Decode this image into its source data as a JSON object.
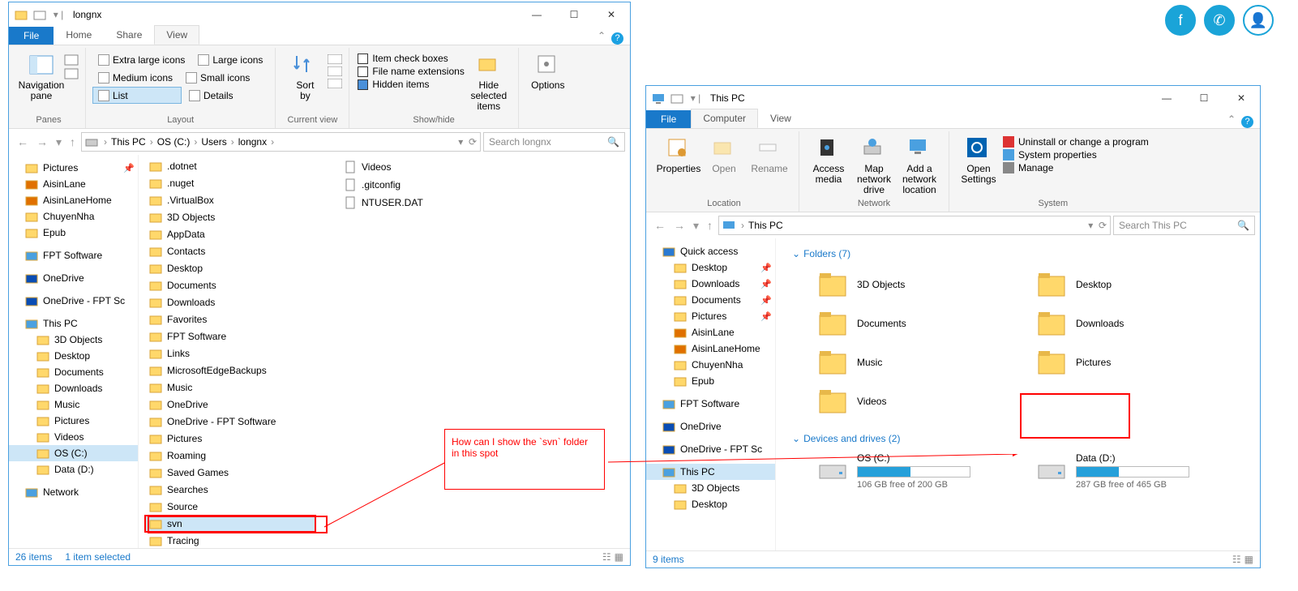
{
  "annotation_text": "How can I show the `svn` folder in this spot",
  "window1": {
    "title": "longnx",
    "tabs": {
      "file": "File",
      "home": "Home",
      "share": "Share",
      "view": "View"
    },
    "ribbon": {
      "panes": "Panes",
      "navpane": "Navigation\npane",
      "layout": "Layout",
      "layout_opts": {
        "xl": "Extra large icons",
        "li": "Large icons",
        "mi": "Medium icons",
        "si": "Small icons",
        "list": "List",
        "details": "Details"
      },
      "currentview": "Current view",
      "sortby": "Sort\nby",
      "showhide": "Show/hide",
      "checks": {
        "icb": "Item check boxes",
        "fne": "File name extensions",
        "hi": "Hidden items"
      },
      "hidesel": "Hide selected\nitems",
      "options": "Options"
    },
    "breadcrumbs": [
      "This PC",
      "OS (C:)",
      "Users",
      "longnx"
    ],
    "search_placeholder": "Search longnx",
    "nav": [
      {
        "t": "Pictures",
        "pin": true
      },
      {
        "t": "AisinLane",
        "pin": false,
        "c": "#e07000"
      },
      {
        "t": "AisinLaneHome",
        "c": "#e07000"
      },
      {
        "t": "ChuyenNha"
      },
      {
        "t": "Epub"
      },
      {
        "t": "",
        "spacer": true
      },
      {
        "t": "FPT Software",
        "c": "#4aa0e0"
      },
      {
        "t": "",
        "spacer": true
      },
      {
        "t": "OneDrive",
        "c": "#0a4db3"
      },
      {
        "t": "",
        "spacer": true
      },
      {
        "t": "OneDrive - FPT Sc",
        "c": "#0a4db3"
      },
      {
        "t": "",
        "spacer": true
      },
      {
        "t": "This PC",
        "c": "#4aa0e0",
        "selectedGroup": true
      },
      {
        "t": "3D Objects",
        "sub": true
      },
      {
        "t": "Desktop",
        "sub": true
      },
      {
        "t": "Documents",
        "sub": true
      },
      {
        "t": "Downloads",
        "sub": true
      },
      {
        "t": "Music",
        "sub": true
      },
      {
        "t": "Pictures",
        "sub": true
      },
      {
        "t": "Videos",
        "sub": true
      },
      {
        "t": "OS (C:)",
        "sub": true,
        "selected": true
      },
      {
        "t": "Data (D:)",
        "sub": true
      },
      {
        "t": "",
        "spacer": true
      },
      {
        "t": "Network",
        "c": "#4aa0e0"
      }
    ],
    "col1": [
      ".dotnet",
      ".nuget",
      ".VirtualBox",
      "3D Objects",
      "AppData",
      "Contacts",
      "Desktop",
      "Documents",
      "Downloads",
      "Favorites",
      "FPT Software",
      "Links",
      "MicrosoftEdgeBackups",
      "Music",
      "OneDrive",
      "OneDrive - FPT Software",
      "Pictures",
      "Roaming",
      "Saved Games",
      "Searches",
      "Source",
      "svn",
      "Tracing"
    ],
    "col2": [
      "Videos",
      ".gitconfig",
      "NTUSER.DAT"
    ],
    "status": {
      "items": "26 items",
      "sel": "1 item selected"
    }
  },
  "window2": {
    "title": "This PC",
    "tabs": {
      "file": "File",
      "computer": "Computer",
      "view": "View"
    },
    "ribbon": {
      "location": "Location",
      "prop": "Properties",
      "open": "Open",
      "rename": "Rename",
      "network": "Network",
      "am": "Access\nmedia",
      "mnd": "Map network\ndrive",
      "anl": "Add a network\nlocation",
      "system": "System",
      "os": "Open\nSettings",
      "links": {
        "u": "Uninstall or change a program",
        "sp": "System properties",
        "m": "Manage"
      }
    },
    "breadcrumb": "This PC",
    "search_placeholder": "Search This PC",
    "nav": [
      {
        "t": "Quick access",
        "c": "#2a7ad2",
        "star": true
      },
      {
        "t": "Desktop",
        "sub": true,
        "pin": true
      },
      {
        "t": "Downloads",
        "sub": true,
        "pin": true
      },
      {
        "t": "Documents",
        "sub": true,
        "pin": true
      },
      {
        "t": "Pictures",
        "sub": true,
        "pin": true
      },
      {
        "t": "AisinLane",
        "sub": true,
        "c": "#e07000"
      },
      {
        "t": "AisinLaneHome",
        "sub": true,
        "c": "#e07000"
      },
      {
        "t": "ChuyenNha",
        "sub": true
      },
      {
        "t": "Epub",
        "sub": true
      },
      {
        "t": "",
        "spacer": true
      },
      {
        "t": "FPT Software",
        "c": "#4aa0e0"
      },
      {
        "t": "",
        "spacer": true
      },
      {
        "t": "OneDrive",
        "c": "#0a4db3"
      },
      {
        "t": "",
        "spacer": true
      },
      {
        "t": "OneDrive - FPT Sc",
        "c": "#0a4db3"
      },
      {
        "t": "",
        "spacer": true
      },
      {
        "t": "This PC",
        "c": "#4aa0e0",
        "selected": true
      },
      {
        "t": "3D Objects",
        "sub": true
      },
      {
        "t": "Desktop",
        "sub": true
      }
    ],
    "folders_hdr": "Folders (7)",
    "folders": [
      "3D Objects",
      "Desktop",
      "Documents",
      "Downloads",
      "Music",
      "Pictures",
      "Videos"
    ],
    "devices_hdr": "Devices and drives (2)",
    "drives": [
      {
        "name": "OS (C:)",
        "free": "106 GB free of 200 GB",
        "pct": 47
      },
      {
        "name": "Data (D:)",
        "free": "287 GB free of 465 GB",
        "pct": 38
      }
    ],
    "status": "9 items"
  }
}
